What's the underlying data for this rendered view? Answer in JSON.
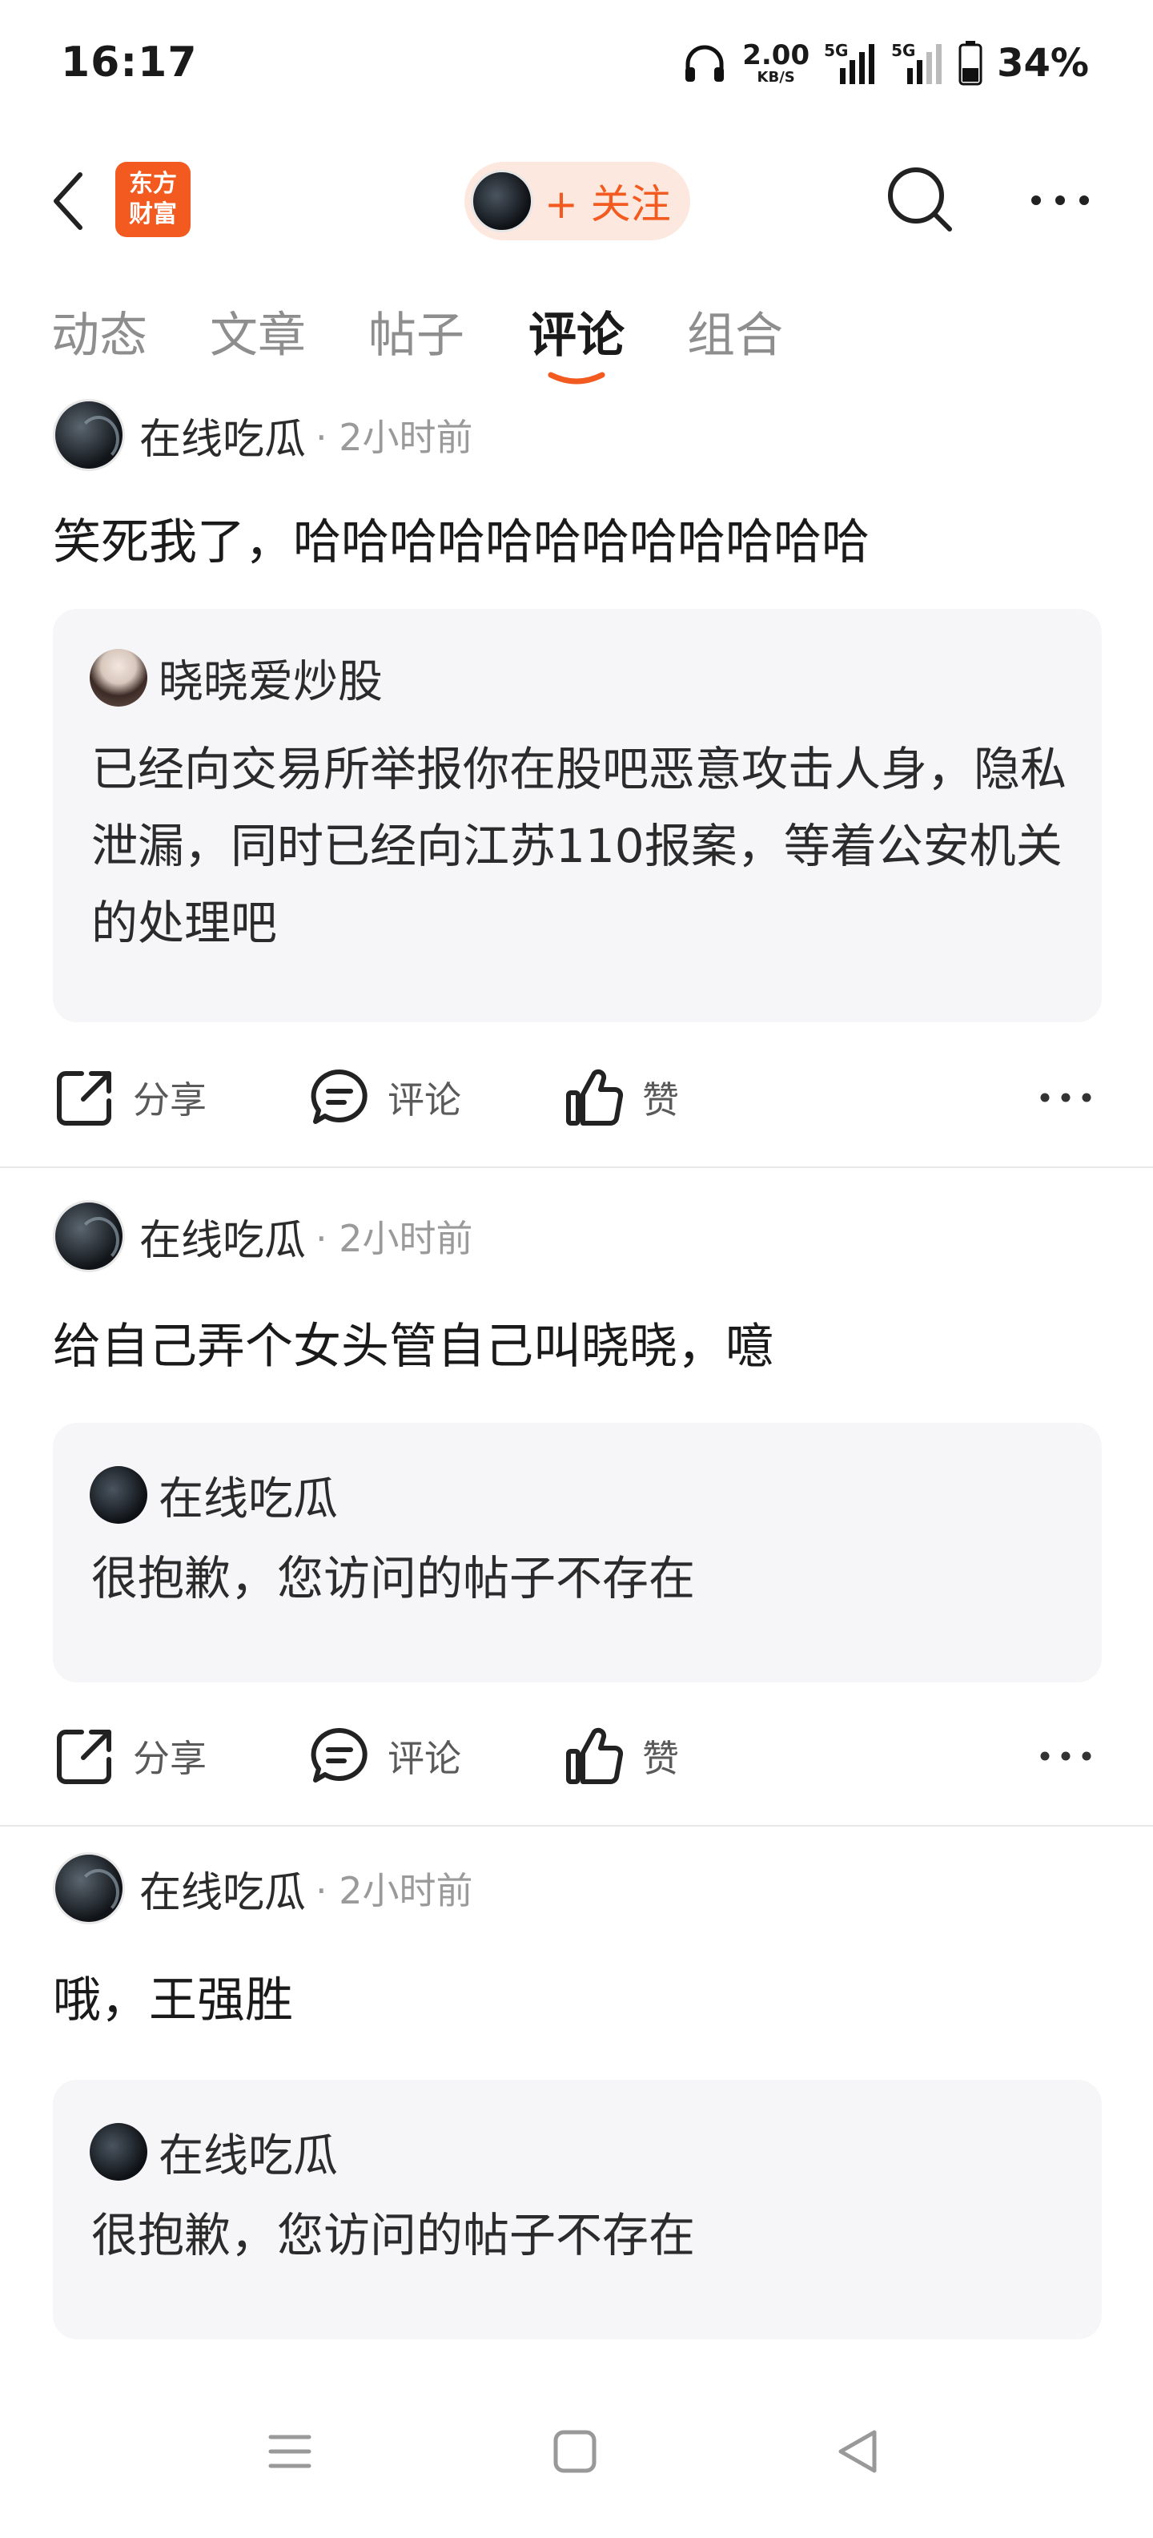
{
  "status_bar": {
    "time": "16:17",
    "net_speed_value": "2.00",
    "net_speed_unit": "KB/S",
    "signal_1_label": "5G",
    "signal_2_label": "5G",
    "battery_percent": "34%",
    "icons": [
      "headphones-icon",
      "signal-icon",
      "signal-icon",
      "battery-icon"
    ]
  },
  "header": {
    "logo_line1": "东方",
    "logo_line2": "财富",
    "follow_label": "+ 关注",
    "icons": [
      "back-arrow-icon",
      "search-icon",
      "more-icon"
    ],
    "accent_color": "#f25a1f"
  },
  "tabs": [
    {
      "label": "动态",
      "active": false
    },
    {
      "label": "文章",
      "active": false
    },
    {
      "label": "帖子",
      "active": false
    },
    {
      "label": "评论",
      "active": true
    },
    {
      "label": "组合",
      "active": false
    }
  ],
  "posts": [
    {
      "author": "在线吃瓜",
      "time": "· 2小时前",
      "text": "笑死我了，哈哈哈哈哈哈哈哈哈哈哈哈",
      "quote": {
        "author": "晓晓爱炒股",
        "text": "已经向交易所举报你在股吧恶意攻击人身，隐私泄漏，同时已经向江苏110报案，等着公安机关的处理吧"
      },
      "actions": {
        "share": "分享",
        "comment": "评论",
        "like": "赞"
      }
    },
    {
      "author": "在线吃瓜",
      "time": "· 2小时前",
      "text": "给自己弄个女头管自己叫晓晓，噫",
      "quote": {
        "author": "在线吃瓜",
        "text": "很抱歉，您访问的帖子不存在"
      },
      "actions": {
        "share": "分享",
        "comment": "评论",
        "like": "赞"
      }
    },
    {
      "author": "在线吃瓜",
      "time": "· 2小时前",
      "text": "哦，王强胜",
      "quote": {
        "author": "在线吃瓜",
        "text": "很抱歉，您访问的帖子不存在"
      }
    }
  ],
  "nav_bar": {
    "icons": [
      "menu-icon",
      "home-square-icon",
      "back-triangle-icon"
    ]
  }
}
